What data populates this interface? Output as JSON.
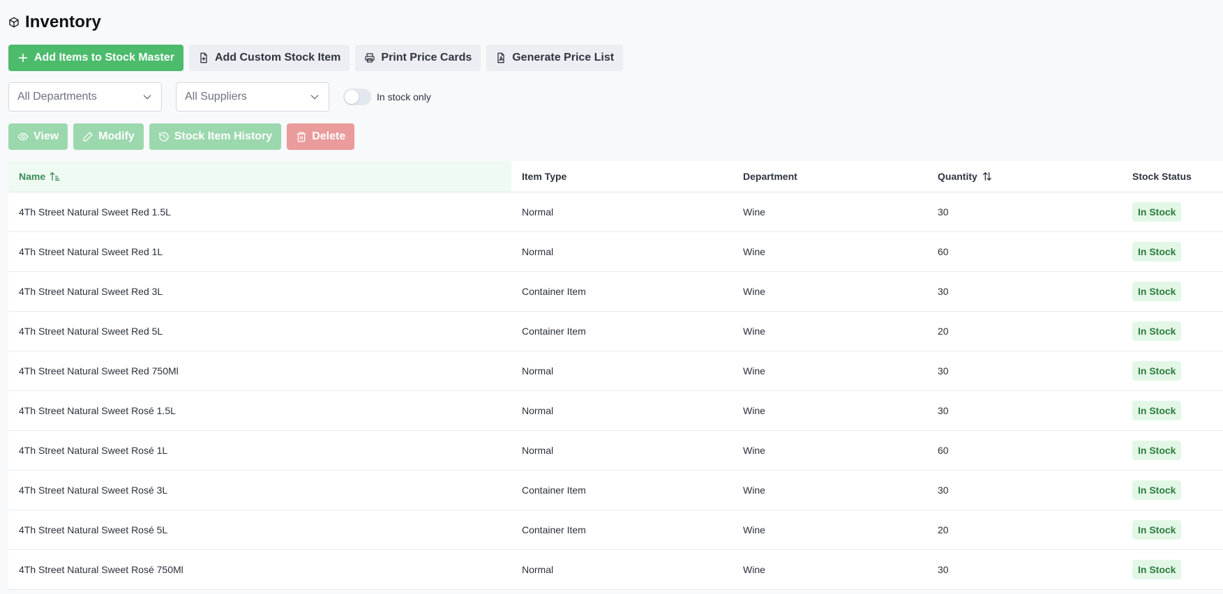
{
  "page": {
    "title": "Inventory",
    "icon": "cube-icon"
  },
  "toolbar": {
    "add_to_master": "Add Items to Stock Master",
    "add_custom": "Add Custom Stock Item",
    "print_cards": "Print Price Cards",
    "generate_list": "Generate Price List"
  },
  "filters": {
    "department": "All Departments",
    "supplier": "All Suppliers",
    "in_stock_label": "In stock only",
    "in_stock_enabled": false
  },
  "actions": {
    "view": "View",
    "modify": "Modify",
    "history": "Stock Item History",
    "delete": "Delete"
  },
  "colors": {
    "primary": "#4cbb6c",
    "primary_disabled": "#9bd8ad",
    "danger_disabled": "#ea9b9b",
    "badge_bg": "#e3f7e7",
    "badge_text": "#2b7c3c"
  },
  "table": {
    "headers": {
      "name": "Name",
      "type": "Item Type",
      "department": "Department",
      "quantity": "Quantity",
      "status": "Stock Status"
    },
    "rows": [
      {
        "name": "4Th Street Natural Sweet Red 1.5L",
        "type": "Normal",
        "department": "Wine",
        "quantity": "30",
        "status": "In Stock"
      },
      {
        "name": "4Th Street Natural Sweet Red 1L",
        "type": "Normal",
        "department": "Wine",
        "quantity": "60",
        "status": "In Stock"
      },
      {
        "name": "4Th Street Natural Sweet Red 3L",
        "type": "Container Item",
        "department": "Wine",
        "quantity": "30",
        "status": "In Stock"
      },
      {
        "name": "4Th Street Natural Sweet Red 5L",
        "type": "Container Item",
        "department": "Wine",
        "quantity": "20",
        "status": "In Stock"
      },
      {
        "name": "4Th Street Natural Sweet Red 750Ml",
        "type": "Normal",
        "department": "Wine",
        "quantity": "30",
        "status": "In Stock"
      },
      {
        "name": "4Th Street Natural Sweet Rosé 1.5L",
        "type": "Normal",
        "department": "Wine",
        "quantity": "30",
        "status": "In Stock"
      },
      {
        "name": "4Th Street Natural Sweet Rosé 1L",
        "type": "Normal",
        "department": "Wine",
        "quantity": "60",
        "status": "In Stock"
      },
      {
        "name": "4Th Street Natural Sweet Rosé 3L",
        "type": "Container Item",
        "department": "Wine",
        "quantity": "30",
        "status": "In Stock"
      },
      {
        "name": "4Th Street Natural Sweet Rosé 5L",
        "type": "Container Item",
        "department": "Wine",
        "quantity": "20",
        "status": "In Stock"
      },
      {
        "name": "4Th Street Natural Sweet Rosé 750Ml",
        "type": "Normal",
        "department": "Wine",
        "quantity": "30",
        "status": "In Stock"
      }
    ]
  }
}
